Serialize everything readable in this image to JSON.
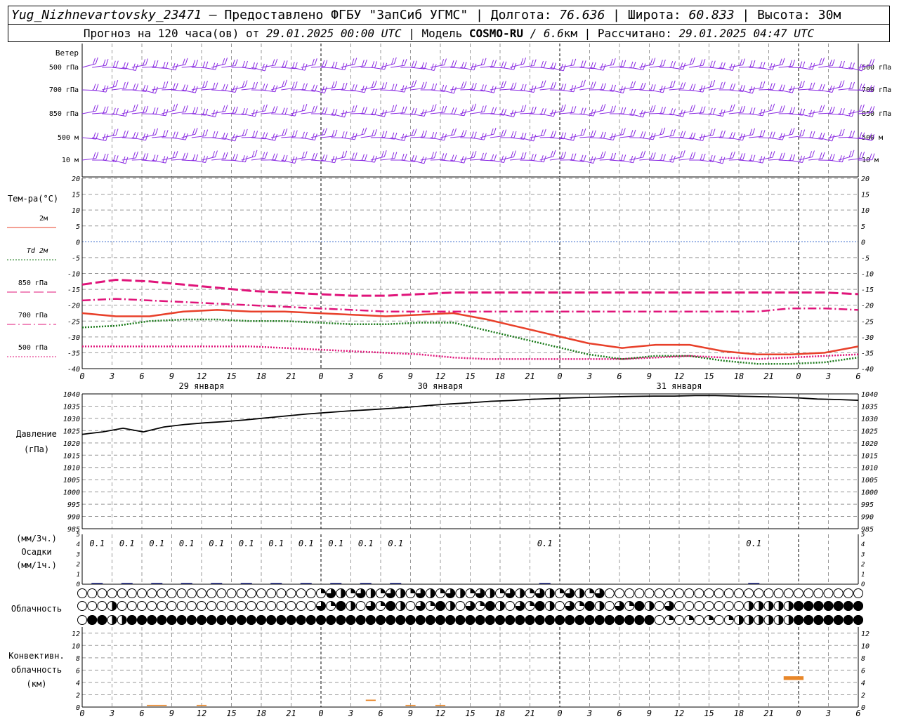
{
  "header": {
    "line1": {
      "station": "Yug_Nizhnevartovsky_23471",
      "dash": " — ",
      "provider": "Предоставлено ФГБУ \"ЗапСиб УГМС\"",
      "sep": " | ",
      "lon_label": "Долгота: ",
      "lon_value": "76.636",
      "lat_label": "Широта: ",
      "lat_value": "60.833",
      "alt_label": "Высота: 30м"
    },
    "line2": {
      "forecast_label": "Прогноз на 120 часа(ов) от ",
      "forecast_from": "29.01.2025 00:00 UTC",
      "model_label": "  | Модель ",
      "model_name": "COSMO-RU",
      "model_res": " / 6.6",
      "model_unit": "км",
      "calc_label": " | Рассчитано: ",
      "calc_value": "29.01.2025 04:47 UTC"
    }
  },
  "chart_data": [
    {
      "type": "wind-barbs",
      "label": "Ветер",
      "levels": [
        "500 гПа",
        "700 гПа",
        "850 гПа",
        "500 м",
        "10  м"
      ],
      "color": "#8a2be2"
    },
    {
      "type": "line",
      "ylabel": "Тем-ра(°C)",
      "ylim": [
        -40,
        20
      ],
      "yticks": [
        20,
        15,
        10,
        5,
        0,
        -5,
        -10,
        -15,
        -20,
        -25,
        -30,
        -35,
        -40
      ],
      "x_hours": [
        0,
        3,
        6,
        9,
        12,
        15,
        18,
        21,
        24,
        27,
        30,
        33,
        36,
        39,
        42,
        45,
        48,
        51,
        54,
        57,
        60,
        63,
        66,
        69,
        72,
        75,
        78
      ],
      "x_ticklabels": [
        "0",
        "3",
        "6",
        "9",
        "12",
        "15",
        "18",
        "21",
        "0",
        "3",
        "6",
        "9",
        "12",
        "15",
        "18",
        "21",
        "0",
        "3",
        "6",
        "9",
        "12",
        "15",
        "18",
        "21",
        "0",
        "3",
        "6"
      ],
      "dates": [
        {
          "label": "29 января",
          "hour": 12
        },
        {
          "label": "30 января",
          "hour": 36
        },
        {
          "label": "31 января",
          "hour": 60
        }
      ],
      "zero_line_color": "#3366cc",
      "series": [
        {
          "name": "2м",
          "color": "#e8402a",
          "style": "solid",
          "values": [
            -22.5,
            -23.5,
            -23.5,
            -22,
            -21.5,
            -22,
            -22,
            -22.5,
            -23,
            -23.5,
            -23,
            -22.5,
            -24.5,
            -27,
            -29.5,
            -32,
            -33.5,
            -32.5,
            -32.5,
            -34.5,
            -35.5,
            -35.5,
            -35,
            -33
          ]
        },
        {
          "name": "Td 2м",
          "color": "#1a7a1a",
          "style": "dotted",
          "values": [
            -27,
            -26.5,
            -25,
            -24.5,
            -24.5,
            -25,
            -25,
            -25.5,
            -26,
            -26,
            -25.5,
            -25.5,
            -28,
            -30.5,
            -33,
            -35.5,
            -37,
            -36,
            -36,
            -37.5,
            -38.5,
            -38.5,
            -38,
            -36.5
          ]
        },
        {
          "name": "850 гПа",
          "color": "#e0147a",
          "style": "long-dash",
          "values": [
            -13.5,
            -12,
            -12.5,
            -13.5,
            -14.5,
            -15.5,
            -16,
            -16.5,
            -17,
            -17,
            -16.5,
            -16,
            -16,
            -16,
            -16,
            -16,
            -16,
            -16,
            -16,
            -16,
            -16,
            -16,
            -16,
            -16.5
          ]
        },
        {
          "name": "700 гПа",
          "color": "#e0147a",
          "style": "dash-dot",
          "values": [
            -18.5,
            -18,
            -18.5,
            -19,
            -19.5,
            -20,
            -20.5,
            -21,
            -21.5,
            -22,
            -22,
            -22,
            -22,
            -22,
            -22,
            -22,
            -22,
            -22,
            -22,
            -22,
            -22,
            -21,
            -21,
            -21.5
          ]
        },
        {
          "name": "500 гПа",
          "color": "#e0147a",
          "style": "dotted",
          "values": [
            -33,
            -33,
            -33,
            -33,
            -33,
            -33,
            -33.5,
            -34,
            -34.5,
            -35,
            -35.5,
            -36.5,
            -37,
            -37,
            -37,
            -37,
            -37,
            -36.5,
            -36,
            -36.5,
            -37,
            -36.5,
            -36,
            -35.5
          ]
        }
      ]
    },
    {
      "type": "line",
      "ylabel": "Давление",
      "ylabel2": "(гПа)",
      "ylim": [
        985,
        1040
      ],
      "yticks": [
        1040,
        1035,
        1030,
        1025,
        1020,
        1015,
        1010,
        1005,
        1000,
        995,
        990,
        985
      ],
      "series": [
        {
          "name": "Давление",
          "color": "#000000",
          "values": [
            1023.5,
            1024.5,
            1026,
            1024.5,
            1026.5,
            1027.5,
            1028.2,
            1028.7,
            1029.4,
            1030.2,
            1031,
            1031.8,
            1032.4,
            1033,
            1033.5,
            1034,
            1034.6,
            1035.3,
            1035.9,
            1036.4,
            1037,
            1037.3,
            1037.8,
            1038.1,
            1038.4,
            1038.6,
            1038.8,
            1039,
            1039.1,
            1039.1,
            1039.3,
            1039.3,
            1039.1,
            1038.9,
            1038.7,
            1038.4,
            1037.9,
            1037.7,
            1037.4
          ]
        }
      ]
    },
    {
      "type": "bar",
      "ylabel": "(мм/3ч.)",
      "ylabel2": "Осадки",
      "ylabel3": "(мм/1ч.)",
      "ylim": [
        0,
        5
      ],
      "yticks": [
        5,
        4,
        3,
        2,
        1,
        0
      ],
      "labels": [
        {
          "hour": 1.5,
          "text": "0.1"
        },
        {
          "hour": 4.5,
          "text": "0.1"
        },
        {
          "hour": 7.5,
          "text": "0.1"
        },
        {
          "hour": 10.5,
          "text": "0.1"
        },
        {
          "hour": 13.5,
          "text": "0.1"
        },
        {
          "hour": 16.5,
          "text": "0.1"
        },
        {
          "hour": 19.5,
          "text": "0.1"
        },
        {
          "hour": 22.5,
          "text": "0.1"
        },
        {
          "hour": 25.5,
          "text": "0.1"
        },
        {
          "hour": 28.5,
          "text": "0.1"
        },
        {
          "hour": 31.5,
          "text": "0.1"
        },
        {
          "hour": 46.5,
          "text": "0.1"
        },
        {
          "hour": 67.5,
          "text": "0.1"
        }
      ]
    },
    {
      "type": "cloud-cover",
      "label": "Облачность",
      "rows": [
        "high",
        "middle",
        "low"
      ]
    },
    {
      "type": "bar",
      "ylabel": "Конвективн.",
      "ylabel2": "облачность",
      "ylabel3": "(км)",
      "ylim": [
        0,
        13
      ],
      "yticks": [
        12,
        10,
        8,
        6,
        4,
        2,
        0
      ],
      "color": "#e8872a",
      "bars": [
        {
          "start": 6.5,
          "end": 8.5,
          "base": 0.2,
          "top": 0.35
        },
        {
          "start": 11.5,
          "end": 12.5,
          "base": 0.2,
          "top": 0.35
        },
        {
          "start": 28.5,
          "end": 29.5,
          "base": 1.0,
          "top": 1.2
        },
        {
          "start": 32.5,
          "end": 33.5,
          "base": 0.2,
          "top": 0.35
        },
        {
          "start": 35.5,
          "end": 36.5,
          "base": 0.2,
          "top": 0.35
        },
        {
          "start": 70.5,
          "end": 72.5,
          "base": 4.4,
          "top": 5.0
        }
      ]
    }
  ]
}
